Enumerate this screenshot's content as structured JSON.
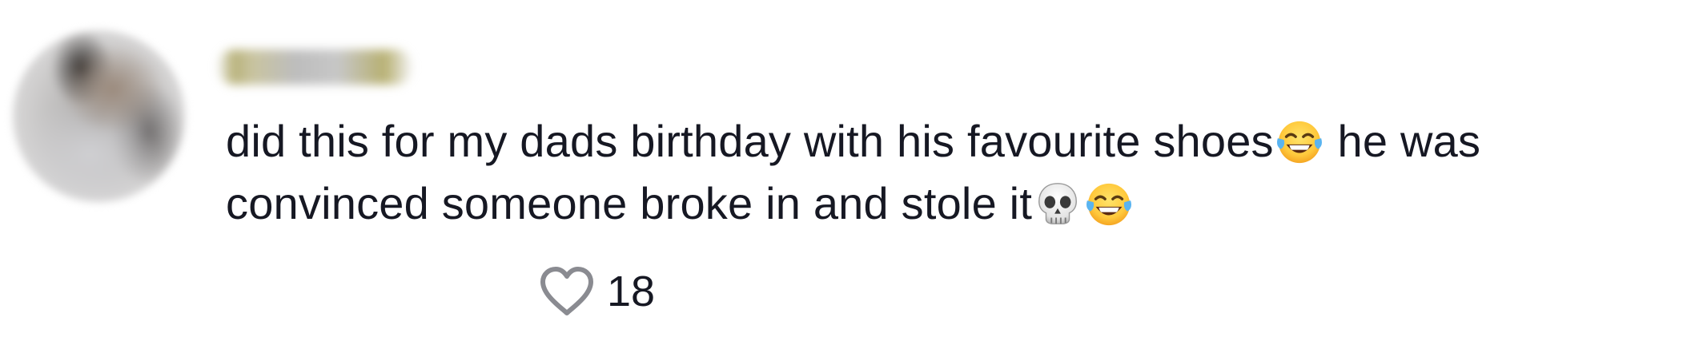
{
  "comment": {
    "username": "username",
    "line1_text": "did this for my dads birthday with his favourite shoes",
    "line1_emoji": "laughing-tears-emoji",
    "line1_after": " he was",
    "line2_text": "convinced someone broke in and stole it",
    "line2_emojis": [
      "skull-emoji",
      "laughing-tears-emoji"
    ],
    "like_icon": "heart-icon",
    "like_count": "18"
  }
}
